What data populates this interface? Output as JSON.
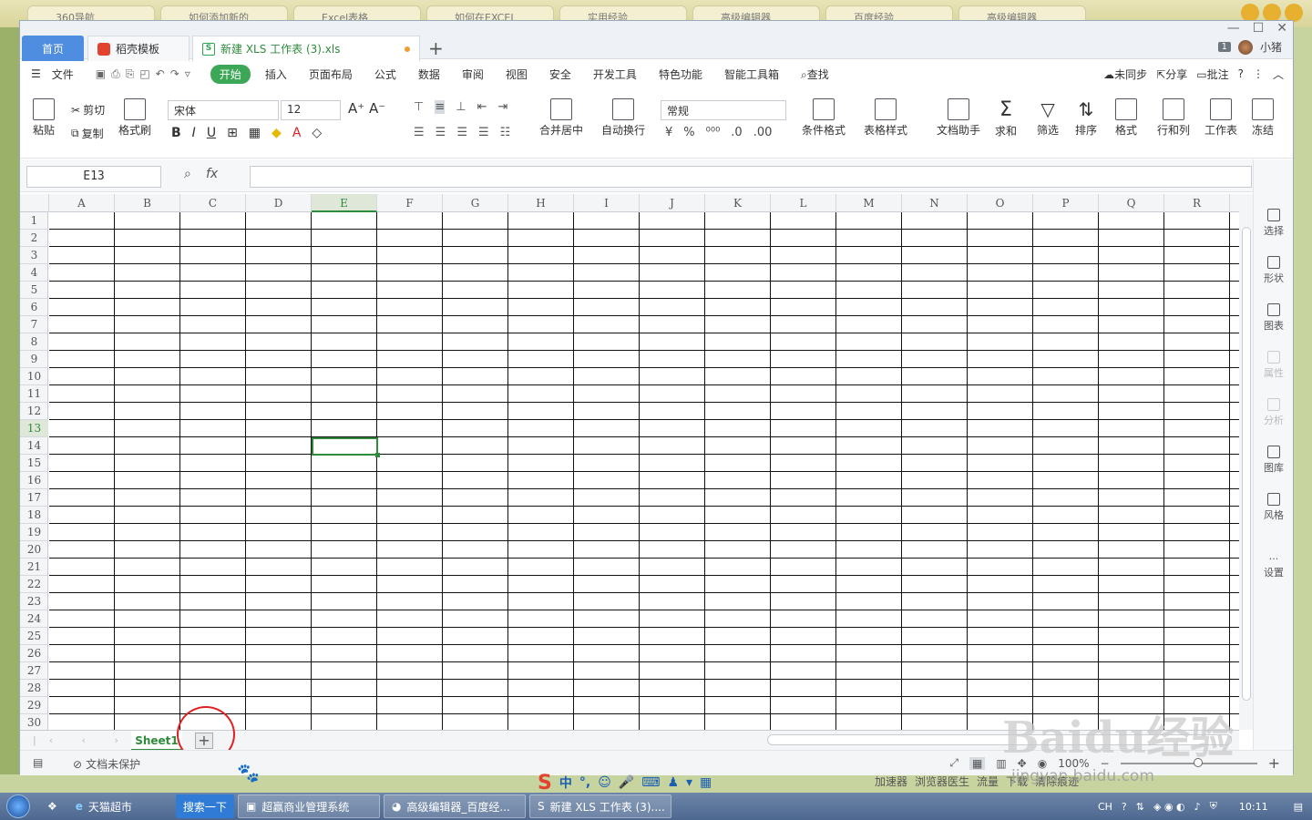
{
  "browser_tabs": [
    "360导航",
    "如何添加新的",
    "Excel表格",
    "如何在EXCEL",
    "实用经验",
    "高级编辑器",
    "百度经验",
    "高级编辑器"
  ],
  "titlebar": {
    "home_tab": "首页",
    "template_tab": "稻壳模板",
    "doc_tab": "新建 XLS 工作表 (3).xls",
    "add_tab": "+",
    "count_badge": "1",
    "user": "小猪"
  },
  "menu": {
    "file": "文件",
    "items": [
      "开始",
      "插入",
      "页面布局",
      "公式",
      "数据",
      "审阅",
      "视图",
      "安全",
      "开发工具",
      "特色功能",
      "智能工具箱",
      "查找"
    ],
    "active": "开始",
    "right": [
      "未同步",
      "分享",
      "批注"
    ]
  },
  "ribbon": {
    "paste": "粘贴",
    "cut": "剪切",
    "copy": "复制",
    "format_painter": "格式刷",
    "font_name": "宋体",
    "font_size": "12",
    "merge_center": "合并居中",
    "wrap_text": "自动换行",
    "number_format": "常规",
    "conditional_format": "条件格式",
    "table_style": "表格样式",
    "doc_assistant": "文档助手",
    "sum": "求和",
    "filter": "筛选",
    "sort": "排序",
    "format": "格式",
    "rows_cols": "行和列",
    "worksheet": "工作表",
    "freeze": "冻结"
  },
  "formula_bar": {
    "name_box": "E13",
    "fx": "fx",
    "content": ""
  },
  "grid": {
    "columns": [
      "A",
      "B",
      "C",
      "D",
      "E",
      "F",
      "G",
      "H",
      "I",
      "J",
      "K",
      "L",
      "M",
      "N",
      "O",
      "P",
      "Q",
      "R"
    ],
    "rows": [
      "1",
      "2",
      "3",
      "4",
      "5",
      "6",
      "7",
      "8",
      "9",
      "10",
      "11",
      "12",
      "13",
      "14",
      "15",
      "16",
      "17",
      "18",
      "19",
      "20",
      "21",
      "22",
      "23",
      "24",
      "25",
      "26",
      "27",
      "28",
      "29",
      "30"
    ],
    "active_cell": "E13"
  },
  "side_panel": [
    "选择",
    "形状",
    "图表",
    "属性",
    "分析",
    "图库",
    "风格",
    "设置"
  ],
  "sheets": {
    "tabs": [
      "Sheet1"
    ],
    "add": "+"
  },
  "status": {
    "protection": "文档未保护",
    "zoom": "100%"
  },
  "ime": {
    "label": "中"
  },
  "overlay_bar": [
    "加速器",
    "浏览器医生",
    "流量",
    "下载",
    "清除痕迹"
  ],
  "watermark": {
    "brand": "Baidu经验",
    "url": "jingyan.baidu.com"
  },
  "taskbar": {
    "items": [
      "天猫超市",
      "搜索一下",
      "超赢商业管理系统",
      "高级编辑器_百度经...",
      "新建 XLS 工作表 (3)...."
    ],
    "lang": "CH",
    "time": "10:11"
  }
}
